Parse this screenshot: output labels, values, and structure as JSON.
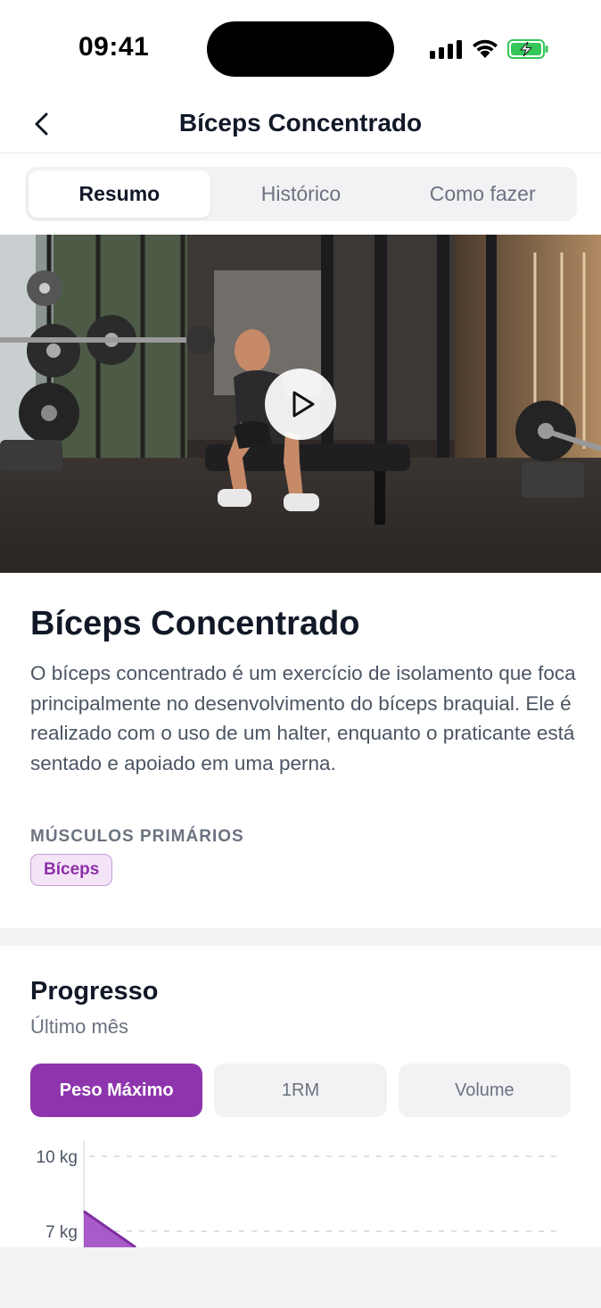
{
  "status_bar": {
    "time": "09:41"
  },
  "header": {
    "title": "Bíceps Concentrado"
  },
  "tabs": [
    {
      "label": "Resumo",
      "active": true
    },
    {
      "label": "Histórico",
      "active": false
    },
    {
      "label": "Como fazer",
      "active": false
    }
  ],
  "exercise": {
    "title": "Bíceps Concentrado",
    "description": "O bíceps concentrado é um exercício de isolamento que foca principalmente no desenvolvimento do bíceps braquial. Ele é realizado com o uso de um halter, enquanto o praticante está sentado e apoiado em uma perna.",
    "primary_muscles_label": "MÚSCULOS PRIMÁRIOS",
    "primary_muscles": [
      "Bíceps"
    ]
  },
  "progress": {
    "title": "Progresso",
    "subtitle": "Último mês",
    "metrics": [
      {
        "label": "Peso Máximo",
        "active": true
      },
      {
        "label": "1RM",
        "active": false
      },
      {
        "label": "Volume",
        "active": false
      }
    ]
  },
  "chart_data": {
    "type": "area",
    "y_tick_labels": [
      "10 kg",
      "7 kg"
    ],
    "y_ticks": [
      10,
      7
    ],
    "grid": true,
    "color": "#9a3fc0"
  },
  "colors": {
    "accent": "#8e35ad",
    "chip_bg": "#f3e5f7",
    "chip_text": "#8e2fa8"
  }
}
